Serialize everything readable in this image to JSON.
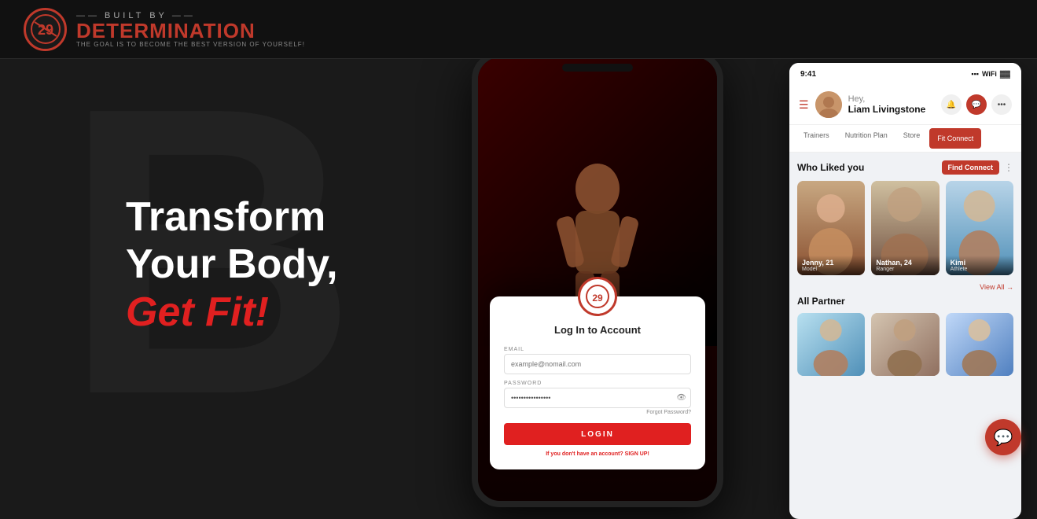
{
  "header": {
    "logo_built_by": "BUILT BY",
    "logo_determination": "DETERMINATION",
    "logo_tagline": "THE GOAL IS TO BECOME THE BEST VERSION OF YOURSELF!"
  },
  "hero": {
    "bg_letter": "B",
    "tagline_line1": "Transform",
    "tagline_line2": "Your Body,",
    "tagline_line3": "Get Fit!"
  },
  "phone_login": {
    "title": "Log In to Account",
    "email_label": "EMAIL",
    "email_placeholder": "example@nomail.com",
    "password_label": "PASSWORD",
    "password_value": "••••••••••••••••",
    "forgot_password": "Forgot Password?",
    "login_button": "LOGIN",
    "no_account_text": "If you don't have an account?",
    "signup_link": "SIGN UP!"
  },
  "app_ui": {
    "status_time": "9:41",
    "user_greeting": "Hey,",
    "user_name": "Liam Livingstone",
    "nav_tabs": [
      "Trainers",
      "Nutrition Plan",
      "Store",
      "Fit Connect"
    ],
    "active_tab": "Fit Connect",
    "who_liked_title": "Who Liked you",
    "find_connect_btn": "Find Connect",
    "profiles": [
      {
        "name": "Jenny, 21",
        "role": "Model"
      },
      {
        "name": "Nathan, 24",
        "role": "Ranger"
      },
      {
        "name": "Kimi",
        "role": "Athlete"
      }
    ],
    "view_all": "View All",
    "all_partner_title": "All Partner"
  },
  "chat": {
    "icon": "💬"
  }
}
